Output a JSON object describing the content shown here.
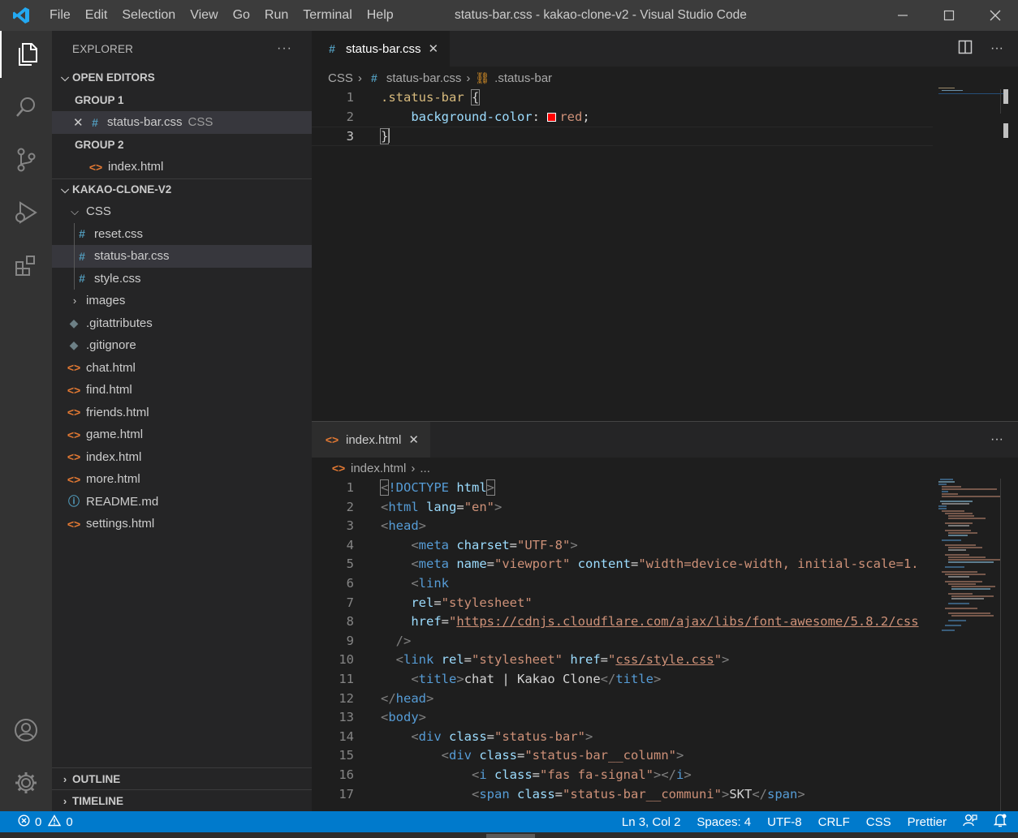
{
  "window": {
    "title": "status-bar.css - kakao-clone-v2 - Visual Studio Code",
    "menu": [
      "File",
      "Edit",
      "Selection",
      "View",
      "Go",
      "Run",
      "Terminal",
      "Help"
    ]
  },
  "sidebar": {
    "header": "EXPLORER",
    "open_editors": {
      "label": "OPEN EDITORS",
      "groups": [
        {
          "label": "GROUP 1",
          "file": "status-bar.css",
          "lang": "CSS"
        },
        {
          "label": "GROUP 2",
          "file": "index.html"
        }
      ]
    },
    "project": {
      "label": "KAKAO-CLONE-V2",
      "css_folder": "CSS",
      "css_files": [
        "reset.css",
        "status-bar.css",
        "style.css"
      ],
      "images_folder": "images",
      "files": [
        ".gitattributes",
        ".gitignore",
        "chat.html",
        "find.html",
        "friends.html",
        "game.html",
        "index.html",
        "more.html",
        "README.md",
        "settings.html"
      ]
    },
    "outline": "OUTLINE",
    "timeline": "TIMELINE"
  },
  "editor_top": {
    "tab": "status-bar.css",
    "breadcrumb": [
      "CSS",
      "status-bar.css",
      ".status-bar"
    ],
    "line_numbers": [
      "1",
      "2",
      "3"
    ],
    "code": {
      "selector": ".status-bar",
      "open_brace": "{",
      "property": "background-color",
      "colon": ":",
      "value": "red",
      "semicolon": ";",
      "close_brace": "}"
    },
    "swatch_color": "#ff0000"
  },
  "editor_bottom": {
    "tab": "index.html",
    "breadcrumb": [
      "index.html",
      "..."
    ],
    "line_numbers": [
      "1",
      "2",
      "3",
      "4",
      "5",
      "6",
      "7",
      "8",
      "9",
      "10",
      "11",
      "12",
      "13",
      "14",
      "15",
      "16",
      "17"
    ],
    "code": {
      "l1": [
        "<",
        "!DOCTYPE",
        " html",
        ">"
      ],
      "l2": [
        "<",
        "html",
        " lang",
        "=",
        "\"en\"",
        ">"
      ],
      "l3": [
        "<",
        "head",
        ">"
      ],
      "l4": [
        "<",
        "meta",
        " charset",
        "=",
        "\"UTF-8\"",
        ">"
      ],
      "l5": [
        "<",
        "meta",
        " name",
        "=",
        "\"viewport\"",
        " content",
        "=",
        "\"width=device-width, initial-scale=1."
      ],
      "l6": [
        "<",
        "link"
      ],
      "l7": [
        "rel",
        "=",
        "\"stylesheet\""
      ],
      "l8": [
        "href",
        "=",
        "\"",
        "https://cdnjs.cloudflare.com/ajax/libs/font-awesome/5.8.2/css"
      ],
      "l9": [
        "/>"
      ],
      "l10": [
        "<",
        "link",
        " rel",
        "=",
        "\"stylesheet\"",
        " href",
        "=",
        "\"",
        "css/style.css",
        "\"",
        ">"
      ],
      "l11": [
        "<",
        "title",
        ">",
        "chat | Kakao Clone",
        "</",
        "title",
        ">"
      ],
      "l12": [
        "</",
        "head",
        ">"
      ],
      "l13": [
        "<",
        "body",
        ">"
      ],
      "l14": [
        "<",
        "div",
        " class",
        "=",
        "\"status-bar\"",
        ">"
      ],
      "l15": [
        "<",
        "div",
        " class",
        "=",
        "\"status-bar__column\"",
        ">"
      ],
      "l16": [
        "<",
        "i",
        " class",
        "=",
        "\"fas fa-signal\"",
        "></",
        "i",
        ">"
      ],
      "l17": [
        "<",
        "span",
        " class",
        "=",
        "\"status-bar__communi\"",
        ">",
        "SKT",
        "</",
        "span",
        ">"
      ]
    }
  },
  "statusbar": {
    "errors": "0",
    "warnings": "0",
    "position": "Ln 3, Col 2",
    "spaces": "Spaces: 4",
    "encoding": "UTF-8",
    "eol": "CRLF",
    "language": "CSS",
    "formatter": "Prettier"
  },
  "colors": {
    "accent": "#007acc",
    "titlebar": "#3c3c3c",
    "activitybar": "#333333",
    "sidebar": "#252526",
    "editor": "#1e1e1e"
  }
}
